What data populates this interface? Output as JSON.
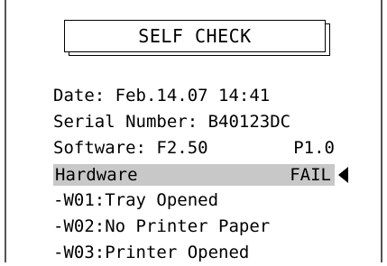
{
  "title": "SELF CHECK",
  "date_line": "Date: Feb.14.07 14:41",
  "serial_line": "Serial Number: B40123DC",
  "software": {
    "label": "Software: F2.50",
    "value": "P1.0"
  },
  "hardware": {
    "label": "Hardware",
    "status": "FAIL",
    "highlight_color": "#c8c8c8"
  },
  "warnings": [
    "-W01:Tray Opened",
    "-W02:No Printer Paper",
    "-W03:Printer Opened"
  ],
  "selector_icon": "left-pointing-triangle"
}
